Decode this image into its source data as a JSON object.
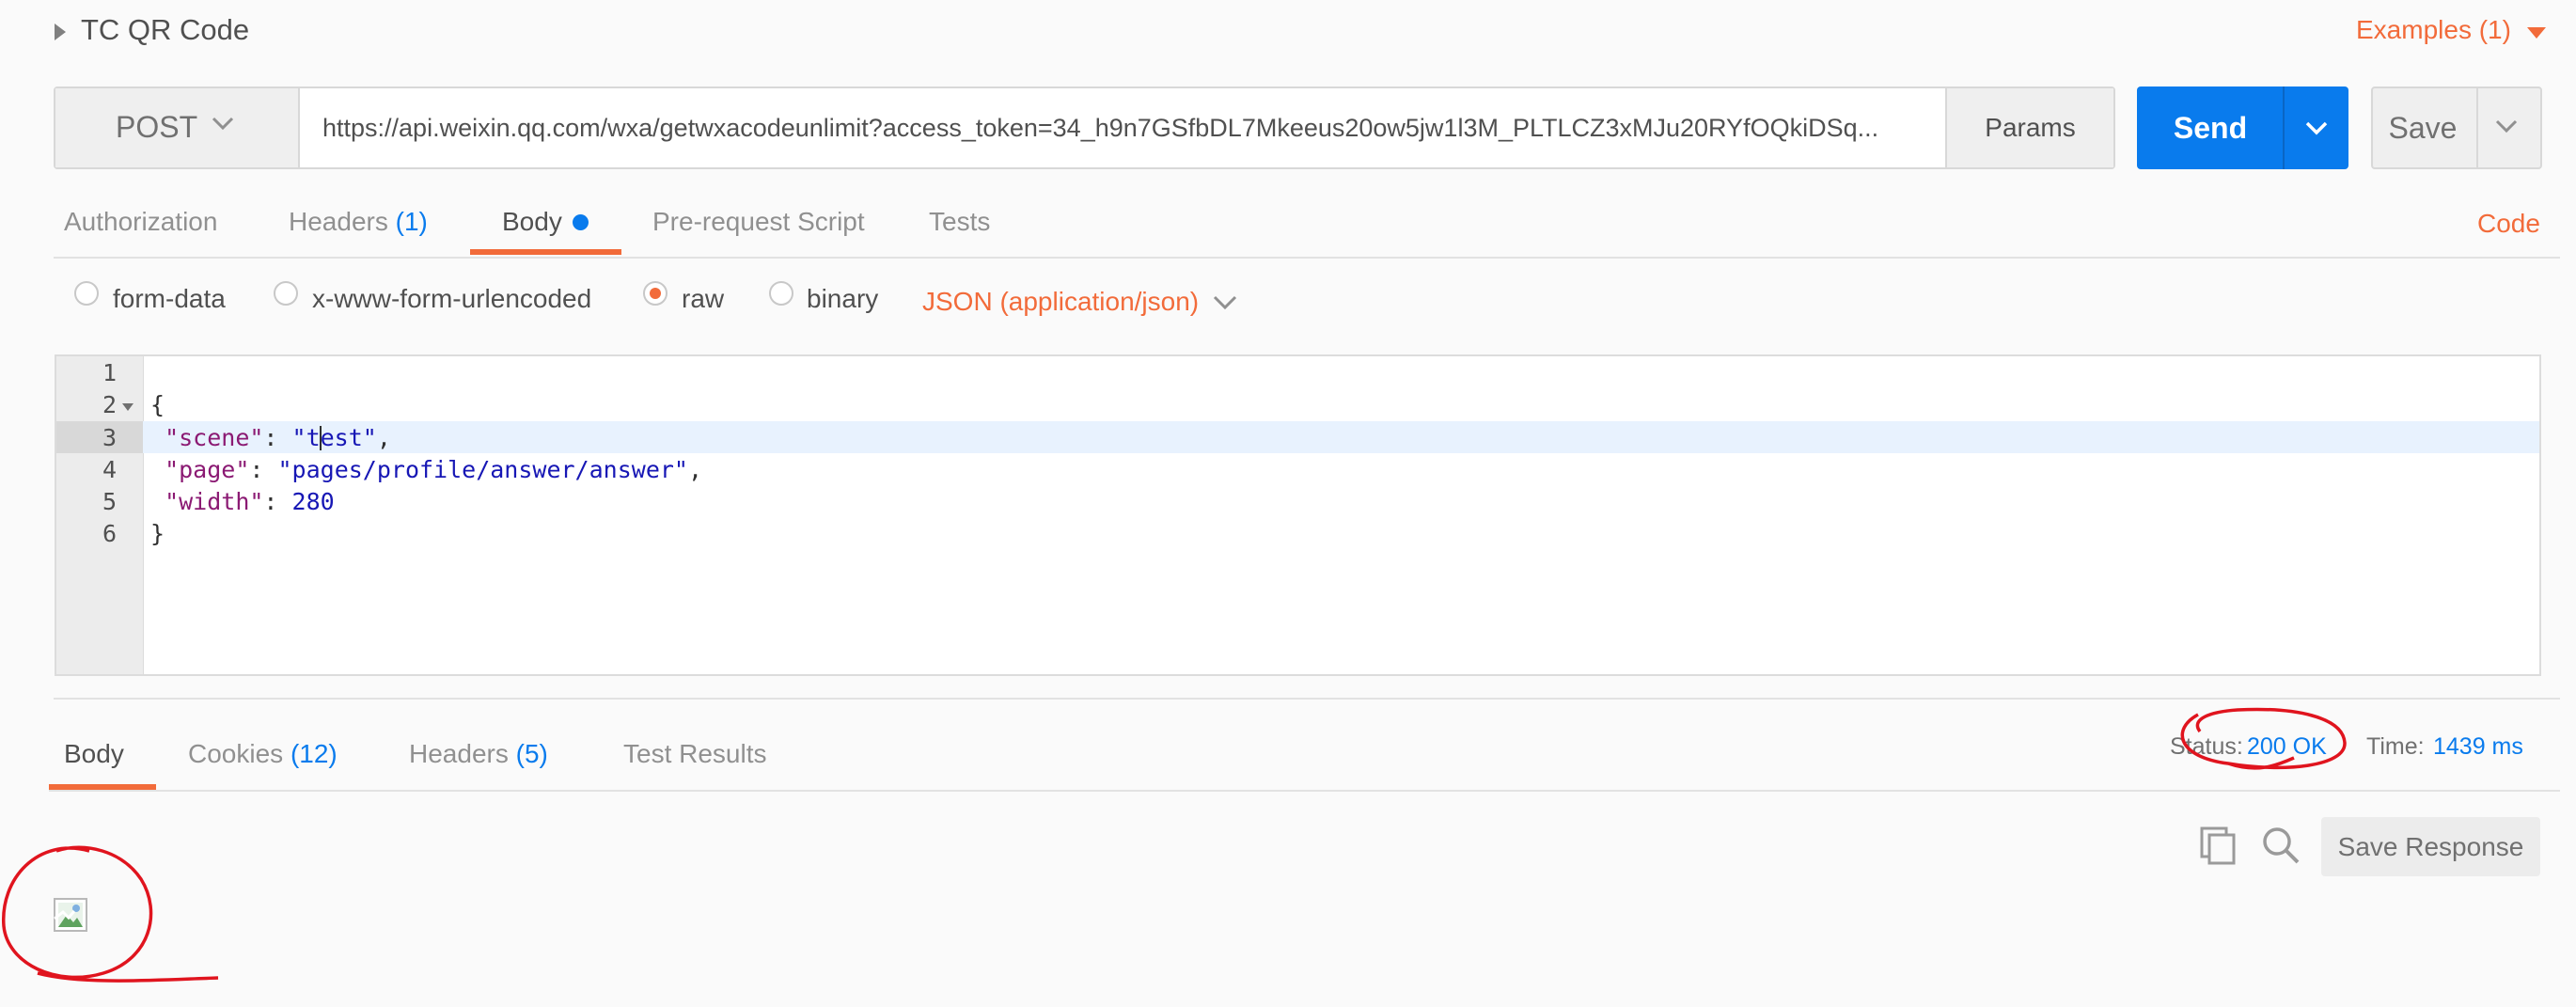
{
  "header": {
    "title": "TC QR Code",
    "examples_label": "Examples (1)"
  },
  "request": {
    "method": "POST",
    "url": "https://api.weixin.qq.com/wxa/getwxacodeunlimit?access_token=34_h9n7GSfbDL7Mkeeus20ow5jw1l3M_PLTLCZ3xMJu20RYfOQkiDSq...",
    "params_label": "Params",
    "send_label": "Send",
    "save_label": "Save"
  },
  "request_tabs": {
    "authorization": "Authorization",
    "headers": "Headers",
    "headers_count": "(1)",
    "body": "Body",
    "prerequest": "Pre-request Script",
    "tests": "Tests",
    "code": "Code"
  },
  "body_types": {
    "form_data": "form-data",
    "urlencoded": "x-www-form-urlencoded",
    "raw": "raw",
    "binary": "binary",
    "selected": "raw",
    "content_type": "JSON (application/json)"
  },
  "editor": {
    "line_numbers": [
      "1",
      "2",
      "3",
      "4",
      "5",
      "6"
    ],
    "open_brace": "{",
    "close_brace": "}",
    "scene_key": "\"scene\"",
    "scene_value": "\"test\"",
    "page_key": "\"page\"",
    "page_value": "\"pages/profile/answer/answer\"",
    "width_key": "\"width\"",
    "width_value": "280",
    "active_line": 3
  },
  "response_tabs": {
    "body": "Body",
    "cookies": "Cookies",
    "cookies_count": "(12)",
    "headers": "Headers",
    "headers_count": "(5)",
    "test_results": "Test Results"
  },
  "response_meta": {
    "status_label": "Status:",
    "status_value": "200 OK",
    "time_label": "Time:",
    "time_value": "1439 ms",
    "save_response_label": "Save Response"
  },
  "colors": {
    "accent_orange": "#f26b3a",
    "send_blue": "#097bed",
    "annotation_red": "#e0141e"
  },
  "icons": [
    "caret-right-icon",
    "chevron-down-icon",
    "copy-icon",
    "search-icon",
    "broken-image-icon"
  ]
}
